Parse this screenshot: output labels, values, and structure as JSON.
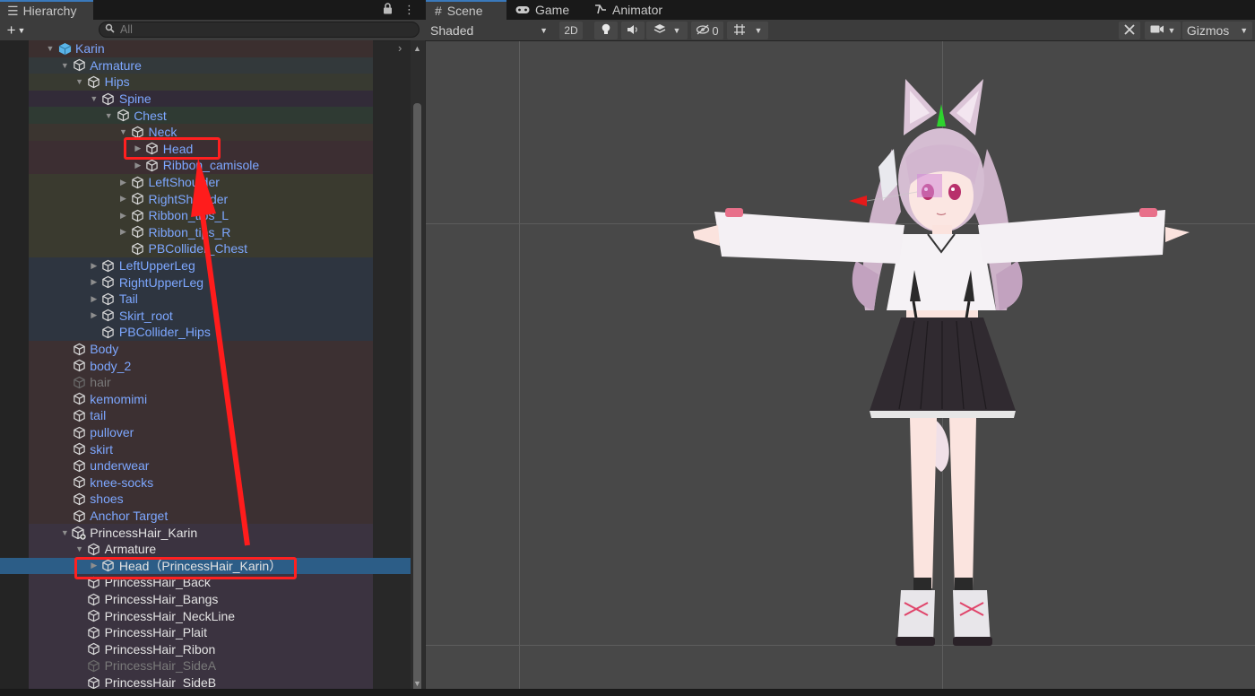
{
  "hierarchy": {
    "tab_label": "Hierarchy",
    "search_placeholder": "All",
    "items": [
      {
        "label": "Karin",
        "depth": 0,
        "arrow": "down",
        "color": "blue",
        "icon": "prefab-cube-icon"
      },
      {
        "label": "Armature",
        "depth": 1,
        "arrow": "down",
        "color": "blue",
        "icon": "cube-icon"
      },
      {
        "label": "Hips",
        "depth": 2,
        "arrow": "down",
        "color": "blue",
        "icon": "cube-icon"
      },
      {
        "label": "Spine",
        "depth": 3,
        "arrow": "down",
        "color": "blue",
        "icon": "cube-icon"
      },
      {
        "label": "Chest",
        "depth": 4,
        "arrow": "down",
        "color": "blue",
        "icon": "cube-icon"
      },
      {
        "label": "Neck",
        "depth": 5,
        "arrow": "down",
        "color": "blue",
        "icon": "cube-icon"
      },
      {
        "label": "Head",
        "depth": 6,
        "arrow": "right",
        "color": "blue",
        "icon": "cube-icon"
      },
      {
        "label": "Ribbon_camisole",
        "depth": 6,
        "arrow": "right",
        "color": "blue",
        "icon": "cube-icon"
      },
      {
        "label": "LeftShoulder",
        "depth": 5,
        "arrow": "right",
        "color": "blue",
        "icon": "cube-icon"
      },
      {
        "label": "RightShoulder",
        "depth": 5,
        "arrow": "right",
        "color": "blue",
        "icon": "cube-icon"
      },
      {
        "label": "Ribbon_tips_L",
        "depth": 5,
        "arrow": "right",
        "color": "blue",
        "icon": "cube-icon"
      },
      {
        "label": "Ribbon_tips_R",
        "depth": 5,
        "arrow": "right",
        "color": "blue",
        "icon": "cube-icon"
      },
      {
        "label": "PBCollider_Chest",
        "depth": 5,
        "arrow": "none",
        "color": "blue",
        "icon": "cube-icon"
      },
      {
        "label": "LeftUpperLeg",
        "depth": 3,
        "arrow": "right",
        "color": "blue",
        "icon": "cube-icon"
      },
      {
        "label": "RightUpperLeg",
        "depth": 3,
        "arrow": "right",
        "color": "blue",
        "icon": "cube-icon"
      },
      {
        "label": "Tail",
        "depth": 3,
        "arrow": "right",
        "color": "blue",
        "icon": "cube-icon"
      },
      {
        "label": "Skirt_root",
        "depth": 3,
        "arrow": "right",
        "color": "blue",
        "icon": "cube-icon"
      },
      {
        "label": "PBCollider_Hips",
        "depth": 3,
        "arrow": "none",
        "color": "blue",
        "icon": "cube-icon"
      },
      {
        "label": "Body",
        "depth": 1,
        "arrow": "none",
        "color": "blue",
        "icon": "cube-icon"
      },
      {
        "label": "body_2",
        "depth": 1,
        "arrow": "none",
        "color": "blue",
        "icon": "cube-icon"
      },
      {
        "label": "hair",
        "depth": 1,
        "arrow": "none",
        "color": "disabled",
        "icon": "cube-icon"
      },
      {
        "label": "kemomimi",
        "depth": 1,
        "arrow": "none",
        "color": "blue",
        "icon": "cube-icon"
      },
      {
        "label": "tail",
        "depth": 1,
        "arrow": "none",
        "color": "blue",
        "icon": "cube-icon"
      },
      {
        "label": "pullover",
        "depth": 1,
        "arrow": "none",
        "color": "blue",
        "icon": "cube-icon"
      },
      {
        "label": "skirt",
        "depth": 1,
        "arrow": "none",
        "color": "blue",
        "icon": "cube-icon"
      },
      {
        "label": "underwear",
        "depth": 1,
        "arrow": "none",
        "color": "blue",
        "icon": "cube-icon"
      },
      {
        "label": "knee-socks",
        "depth": 1,
        "arrow": "none",
        "color": "blue",
        "icon": "cube-icon"
      },
      {
        "label": "shoes",
        "depth": 1,
        "arrow": "none",
        "color": "blue",
        "icon": "cube-icon"
      },
      {
        "label": "Anchor Target",
        "depth": 1,
        "arrow": "none",
        "color": "blue",
        "icon": "cube-icon"
      },
      {
        "label": "PrincessHair_Karin",
        "depth": 1,
        "arrow": "down",
        "color": "white",
        "icon": "cube-plus-icon"
      },
      {
        "label": "Armature",
        "depth": 2,
        "arrow": "down",
        "color": "white",
        "icon": "cube-icon"
      },
      {
        "label": "Head（PrincessHair_Karin）",
        "depth": 3,
        "arrow": "right",
        "color": "white",
        "icon": "cube-icon",
        "selected": true
      },
      {
        "label": "PrincessHair_Back",
        "depth": 2,
        "arrow": "none",
        "color": "white",
        "icon": "cube-icon"
      },
      {
        "label": "PrincessHair_Bangs",
        "depth": 2,
        "arrow": "none",
        "color": "white",
        "icon": "cube-icon"
      },
      {
        "label": "PrincessHair_NeckLine",
        "depth": 2,
        "arrow": "none",
        "color": "white",
        "icon": "cube-icon"
      },
      {
        "label": "PrincessHair_Plait",
        "depth": 2,
        "arrow": "none",
        "color": "white",
        "icon": "cube-icon"
      },
      {
        "label": "PrincessHair_Ribon",
        "depth": 2,
        "arrow": "none",
        "color": "white",
        "icon": "cube-icon"
      },
      {
        "label": "PrincessHair_SideA",
        "depth": 2,
        "arrow": "none",
        "color": "disabled",
        "icon": "cube-icon"
      },
      {
        "label": "PrincessHair_SideB",
        "depth": 2,
        "arrow": "none",
        "color": "white",
        "icon": "cube-icon"
      }
    ]
  },
  "scene": {
    "tabs": [
      {
        "label": "Scene",
        "icon": "grid-icon"
      },
      {
        "label": "Game",
        "icon": "gamepad-icon"
      },
      {
        "label": "Animator",
        "icon": "animator-icon"
      }
    ],
    "shading_mode": "Shaded",
    "toggle_2d": "2D",
    "hidden_count": "0",
    "gizmos_label": "Gizmos"
  },
  "colors": {
    "accent_blue": "#3a79bb",
    "selection": "#2c5d87",
    "prefab_text": "#7da7ff",
    "annotation_red": "#ff2020"
  }
}
